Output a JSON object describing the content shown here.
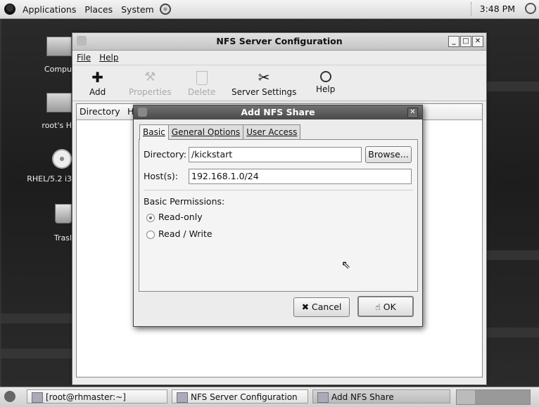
{
  "top_panel": {
    "menus": [
      "Applications",
      "Places",
      "System"
    ],
    "clock": "3:48 PM"
  },
  "desktop_icons": [
    {
      "label": "Compu"
    },
    {
      "label": "root's H"
    },
    {
      "label": "RHEL/5.2 i3"
    },
    {
      "label": "Trasl"
    }
  ],
  "nfs_window": {
    "title": "NFS Server Configuration",
    "menus": [
      "File",
      "Help"
    ],
    "toolbar": {
      "add": "Add",
      "properties": "Properties",
      "delete": "Delete",
      "server_settings": "Server Settings",
      "help": "Help"
    },
    "list_columns": [
      "Directory",
      "Ho"
    ]
  },
  "dialog": {
    "title": "Add NFS Share",
    "tabs": [
      "Basic",
      "General Options",
      "User Access"
    ],
    "directory_label": "Directory:",
    "directory_value": "/kickstart",
    "browse": "Browse...",
    "hosts_label": "Host(s):",
    "hosts_value": "192.168.1.0/24",
    "permissions_heading": "Basic Permissions:",
    "read_only": "Read-only",
    "read_write": "Read / Write",
    "selected_permission": "Read-only",
    "cancel": "Cancel",
    "ok": "OK"
  },
  "taskbar": {
    "items": [
      "[root@rhmaster:~]",
      "NFS Server Configuration",
      "Add NFS Share"
    ]
  }
}
